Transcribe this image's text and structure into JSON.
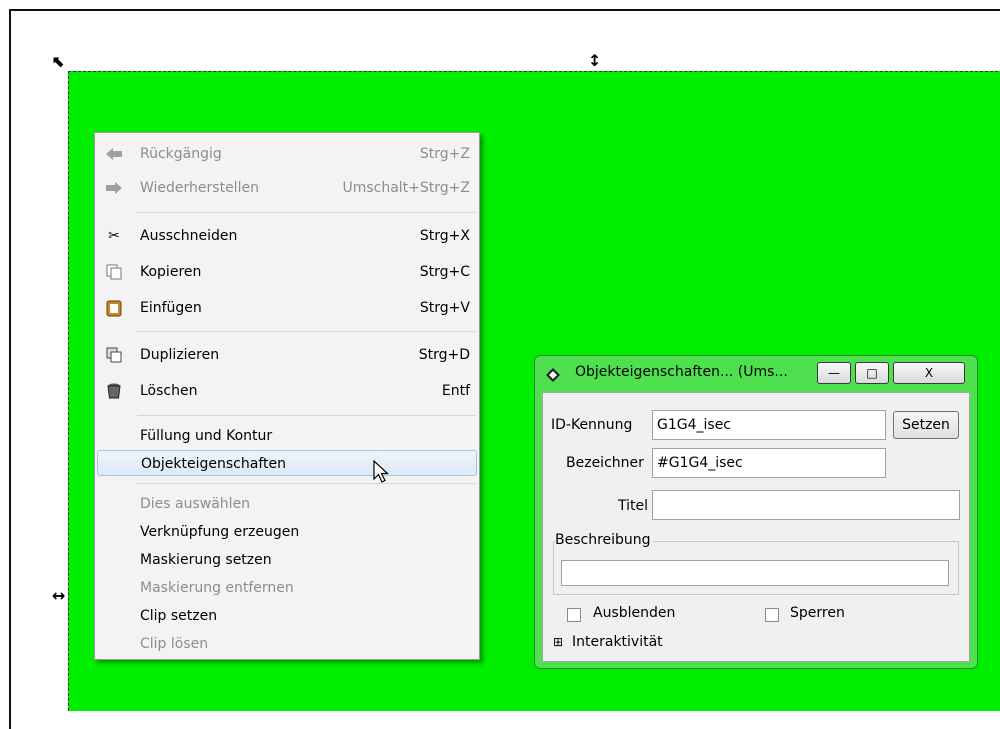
{
  "canvas": {
    "background_color": "#00ee00"
  },
  "context_menu": {
    "items": [
      {
        "label": "Rückgängig",
        "shortcut": "Strg+Z",
        "icon": "undo-icon",
        "disabled": true
      },
      {
        "label": "Wiederherstellen",
        "shortcut": "Umschalt+Strg+Z",
        "icon": "redo-icon",
        "disabled": true
      },
      {
        "label": "Ausschneiden",
        "shortcut": "Strg+X",
        "icon": "cut-icon",
        "disabled": false
      },
      {
        "label": "Kopieren",
        "shortcut": "Strg+C",
        "icon": "copy-icon",
        "disabled": false
      },
      {
        "label": "Einfügen",
        "shortcut": "Strg+V",
        "icon": "paste-icon",
        "disabled": false
      },
      {
        "label": "Duplizieren",
        "shortcut": "Strg+D",
        "icon": "duplicate-icon",
        "disabled": false
      },
      {
        "label": "Löschen",
        "shortcut": "Entf",
        "icon": "delete-icon",
        "disabled": false
      },
      {
        "label": "Füllung und Kontur",
        "shortcut": "",
        "disabled": false
      },
      {
        "label": "Objekteigenschaften",
        "shortcut": "",
        "disabled": false,
        "highlighted": true
      },
      {
        "label": "Dies auswählen",
        "shortcut": "",
        "disabled": true
      },
      {
        "label": "Verknüpfung erzeugen",
        "shortcut": "",
        "disabled": false
      },
      {
        "label": "Maskierung setzen",
        "shortcut": "",
        "disabled": false
      },
      {
        "label": "Maskierung entfernen",
        "shortcut": "",
        "disabled": true
      },
      {
        "label": "Clip setzen",
        "shortcut": "",
        "disabled": false
      },
      {
        "label": "Clip lösen",
        "shortcut": "",
        "disabled": true
      }
    ]
  },
  "dialog": {
    "title": "Objekteigenschaften... (Ums...",
    "minimize_glyph": "—",
    "maximize_glyph": "□",
    "close_glyph": "X",
    "id_label": "ID-Kennung",
    "id_value": "G1G4_isec",
    "set_button": "Setzen",
    "label_label": "Bezeichner",
    "label_value": "#G1G4_isec",
    "title_label": "Titel",
    "title_value": "",
    "description_label": "Beschreibung",
    "description_value": "",
    "hide_label": "Ausblenden",
    "hide_checked": false,
    "lock_label": "Sperren",
    "lock_checked": false,
    "interactivity_label": "Interaktivität",
    "expander_glyph": "⊞"
  }
}
